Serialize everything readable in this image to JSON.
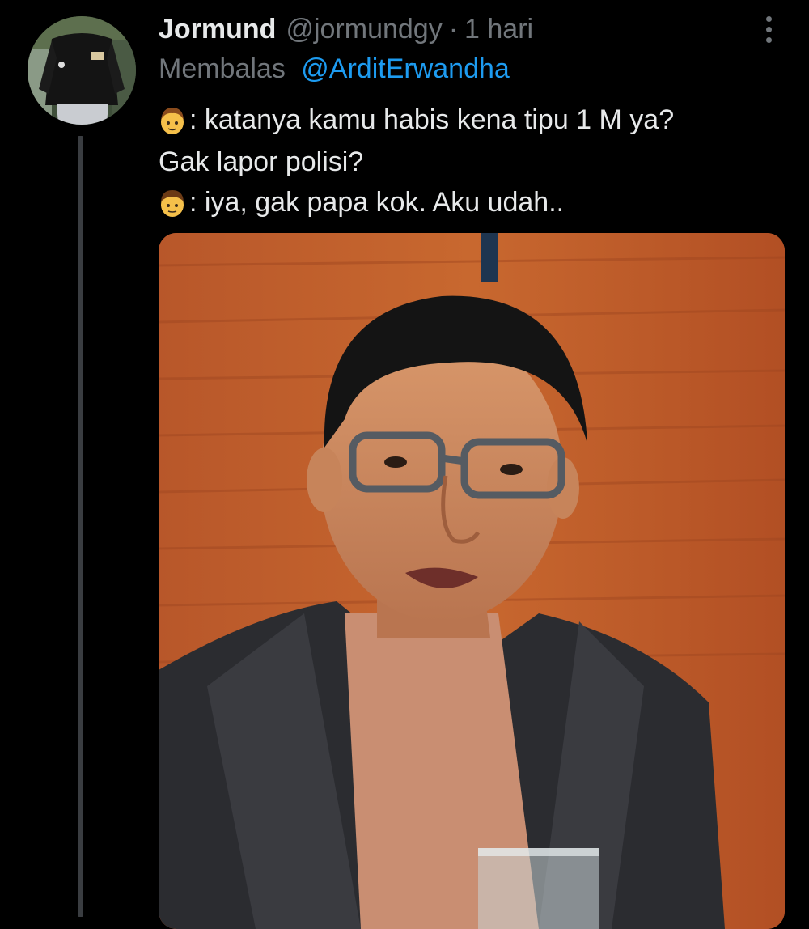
{
  "tweet": {
    "display_name": "Jormund",
    "handle": "@jormundgy",
    "separator": "·",
    "time": "1 hari",
    "reply_label": "Membalas",
    "reply_to": "@ArditErwandha",
    "lines": [
      ": katanya kamu habis kena tipu 1 M ya?",
      "Gak lapor polisi?",
      ": iya, gak papa kok. Aku udah.."
    ],
    "emoji_icons": [
      "boy-face-emoji",
      "man-face-emoji"
    ],
    "media_icon": "photo-man-with-glasses"
  },
  "colors": {
    "background": "#000000",
    "text": "#e7e9ea",
    "muted": "#71767b",
    "link": "#1d9bf0",
    "thread_line": "#3a3d41"
  }
}
